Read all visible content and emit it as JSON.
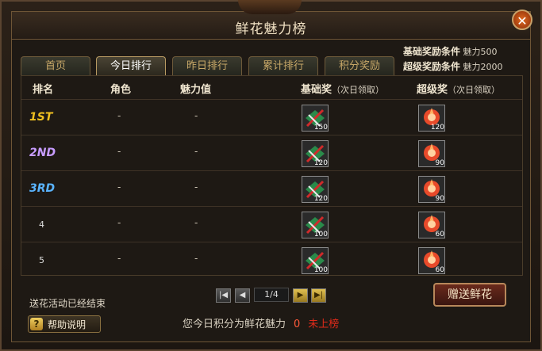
{
  "window": {
    "title": "鲜花魅力榜"
  },
  "conditions": {
    "basic_label": "基础奖励条件",
    "basic_value": "魅力500",
    "super_label": "超级奖励条件",
    "super_value": "魅力2000"
  },
  "tabs": [
    {
      "label": "首页",
      "active": false
    },
    {
      "label": "今日排行",
      "active": true
    },
    {
      "label": "昨日排行",
      "active": false
    },
    {
      "label": "累计排行",
      "active": false
    },
    {
      "label": "积分奖励",
      "active": false
    }
  ],
  "table": {
    "headers": {
      "rank": "排名",
      "role": "角色",
      "charm": "魅力值",
      "basic": "基础奖",
      "basic_note": "（次日领取）",
      "super": "超级奖",
      "super_note": "（次日领取）"
    },
    "rows": [
      {
        "rank": "1ST",
        "role": "-",
        "charm": "-",
        "basic_count": "150",
        "super_count": "120"
      },
      {
        "rank": "2ND",
        "role": "-",
        "charm": "-",
        "basic_count": "120",
        "super_count": "90"
      },
      {
        "rank": "3RD",
        "role": "-",
        "charm": "-",
        "basic_count": "120",
        "super_count": "90"
      },
      {
        "rank": "4",
        "role": "-",
        "charm": "-",
        "basic_count": "100",
        "super_count": "60"
      },
      {
        "rank": "5",
        "role": "-",
        "charm": "-",
        "basic_count": "100",
        "super_count": "60"
      }
    ]
  },
  "pager": {
    "text": "1/4"
  },
  "status": "送花活动已经结束",
  "help": {
    "label": "帮助说明"
  },
  "gift_button": "赠送鲜花",
  "footer": {
    "prefix": "您今日积分为鲜花魅力",
    "value": "0",
    "status": "未上榜"
  },
  "colors": {
    "rank1": "#f0c020",
    "rank2": "#c79cff",
    "rank3": "#5ab4ff",
    "accent": "#c9a26a"
  }
}
